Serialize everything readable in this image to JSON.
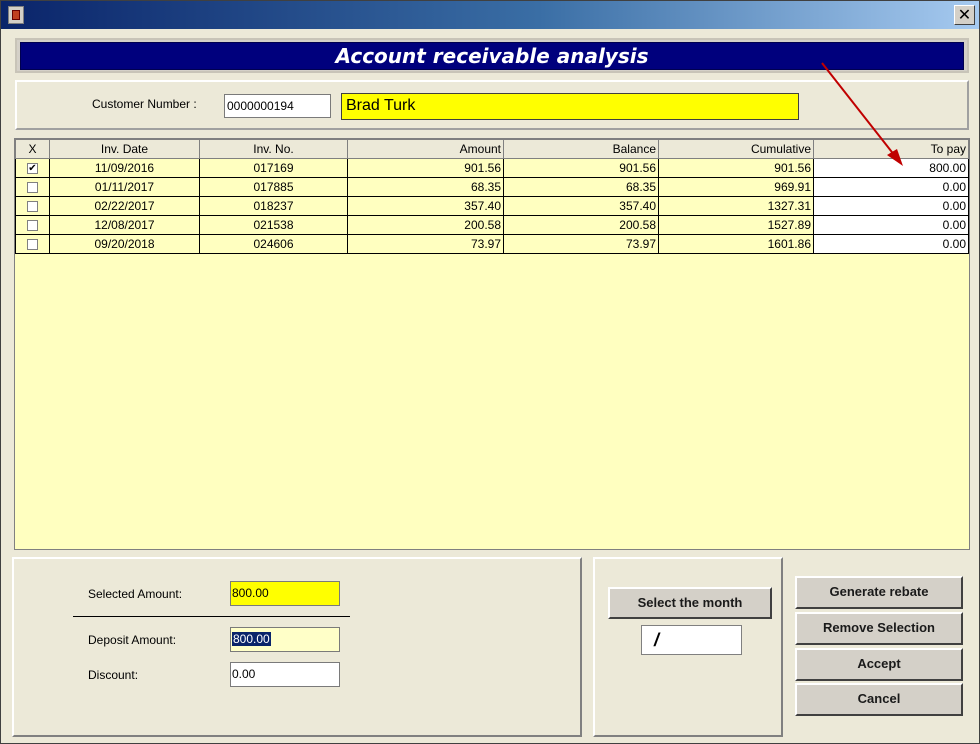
{
  "window": {
    "close_glyph": "✕"
  },
  "header": {
    "title": "Account receivable analysis"
  },
  "customer": {
    "number_label": "Customer Number :",
    "number_value": "0000000194",
    "name_value": "Brad Turk"
  },
  "grid": {
    "columns": [
      "X",
      "Inv. Date",
      "Inv. No.",
      "Amount",
      "Balance",
      "Cumulative",
      "To pay"
    ],
    "rows": [
      {
        "checked": true,
        "check": "✔",
        "date": "11/09/2016",
        "invno": "017169",
        "amount": "901.56",
        "balance": "901.56",
        "cumulative": "901.56",
        "topay": "800.00"
      },
      {
        "checked": false,
        "check": "",
        "date": "01/11/2017",
        "invno": "017885",
        "amount": "68.35",
        "balance": "68.35",
        "cumulative": "969.91",
        "topay": "0.00"
      },
      {
        "checked": false,
        "check": "",
        "date": "02/22/2017",
        "invno": "018237",
        "amount": "357.40",
        "balance": "357.40",
        "cumulative": "1327.31",
        "topay": "0.00"
      },
      {
        "checked": false,
        "check": "",
        "date": "12/08/2017",
        "invno": "021538",
        "amount": "200.58",
        "balance": "200.58",
        "cumulative": "1527.89",
        "topay": "0.00"
      },
      {
        "checked": false,
        "check": "",
        "date": "09/20/2018",
        "invno": "024606",
        "amount": "73.97",
        "balance": "73.97",
        "cumulative": "1601.86",
        "topay": "0.00"
      }
    ]
  },
  "amounts": {
    "selected_label": "Selected Amount:",
    "selected_value": "800.00",
    "deposit_label": "Deposit Amount:",
    "deposit_value": "800.00",
    "discount_label": "Discount:",
    "discount_value": "0.00"
  },
  "month": {
    "button_label": "Select the month",
    "display_value": "/"
  },
  "actions": {
    "generate_rebate": "Generate rebate",
    "remove_selection": "Remove Selection",
    "accept": "Accept",
    "cancel": "Cancel"
  },
  "colors": {
    "title_bar": "#00007d",
    "grid_background": "#ffffc0",
    "highlight_yellow": "#ffff00",
    "annotation_arrow": "#c00000"
  },
  "icons": {
    "app": "app-icon",
    "close": "close-icon",
    "annotation": "red-arrow"
  }
}
